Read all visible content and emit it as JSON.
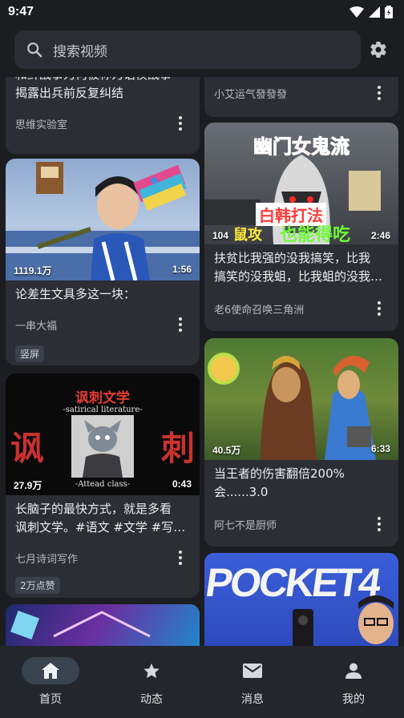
{
  "status": {
    "time": "9:47"
  },
  "search": {
    "placeholder": "搜索视频"
  },
  "feed": {
    "left": [
      {
        "title_lines": [
          "和鲜战事为何被称为语模战事",
          "揭露出兵前反复纠结"
        ],
        "author": "思维实验室"
      },
      {
        "views": "1119.1万",
        "duration": "1:56",
        "title_lines": [
          "论差生文具多这一块："
        ],
        "author": "一串大福",
        "tag": "竖屏"
      },
      {
        "views": "27.9万",
        "duration": "0:43",
        "thumb_text": {
          "main": "讽刺文学",
          "sub": "-satirical literature-",
          "left": "讽",
          "right": "刺",
          "caption": "-Attead class-"
        },
        "title_lines": [
          "长脑子的最快方式，就是多看",
          "讽刺文学。#语文 #文学 #写…"
        ],
        "author": "七月诗词写作",
        "tag": "2万点赞"
      },
      {}
    ],
    "right": [
      {
        "author": "小艾运气發發發"
      },
      {
        "views": "104",
        "duration": "2:46",
        "thumb_text": {
          "top": "幽门女鬼流",
          "mid": "白韩打法",
          "bottom_a": "鼠攻",
          "bottom_b": "也能得吃"
        },
        "title_lines": [
          "扶贫比我强的没我搞笑，比我",
          "搞笑的没我蛆，比我蛆的没我…"
        ],
        "author": "老6使命召唤三角洲"
      },
      {
        "views": "40.5万",
        "duration": "6:33",
        "title_lines": [
          "当王者的伤害翻倍200%",
          "会......3.0"
        ],
        "author": "阿七不是厨师"
      },
      {
        "thumb_text": {
          "big": "POCKET4"
        }
      }
    ]
  },
  "nav": [
    {
      "label": "首页",
      "icon": "home-icon"
    },
    {
      "label": "动态",
      "icon": "star-icon"
    },
    {
      "label": "消息",
      "icon": "mail-icon"
    },
    {
      "label": "我的",
      "icon": "person-icon"
    }
  ],
  "colors": {
    "background": "#1b1d21",
    "card": "#2b2e34",
    "nav": "#23262b",
    "nav_active": "#3a4350"
  }
}
